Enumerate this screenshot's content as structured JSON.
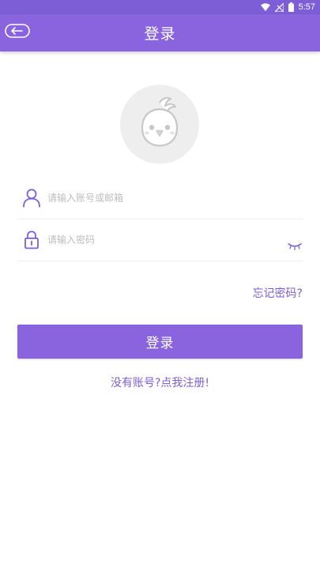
{
  "status_bar": {
    "time": "5:57",
    "icons": [
      "wifi-icon",
      "signal-off-icon",
      "battery-icon"
    ]
  },
  "app_bar": {
    "title": "登录",
    "back_icon": "back-arrow-icon"
  },
  "avatar": {
    "icon": "bird-mascot-icon"
  },
  "form": {
    "account": {
      "icon": "user-icon",
      "placeholder": "请输入账号或邮箱",
      "value": ""
    },
    "password": {
      "icon": "lock-icon",
      "placeholder": "请输入密码",
      "value": "",
      "toggle_icon": "eye-closed-icon"
    },
    "forgot_label": "忘记密码?",
    "login_label": "登录",
    "register_label": "没有账号?点我注册!"
  },
  "colors": {
    "primary": "#8a64de",
    "status_bar": "#7d5ed6",
    "link": "#7d5ed6",
    "placeholder": "#bdbdbd",
    "divider": "#eeeeee"
  }
}
